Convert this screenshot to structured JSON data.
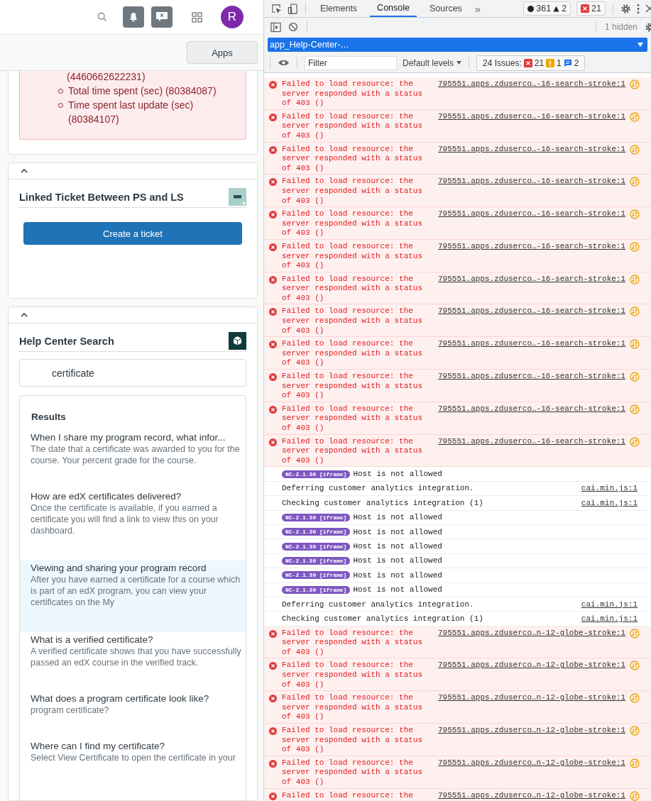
{
  "topbar": {
    "avatar_letter": "R"
  },
  "subbar": {
    "apps_button": "Apps"
  },
  "alert_card": {
    "lines": [
      {
        "kind": "tail",
        "text": "(4460662622231)"
      },
      {
        "kind": "bullet",
        "text": "Total time spent (sec) (80384087)"
      },
      {
        "kind": "bullet",
        "text": "Time spent last update (sec) (80384107)"
      }
    ]
  },
  "linked_ticket_card": {
    "expanded": true,
    "title": "Linked Ticket Between PS and LS",
    "button": "Create a ticket"
  },
  "help_center_card": {
    "expanded": true,
    "title": "Help Center Search",
    "search": {
      "value": "certificate"
    },
    "results_heading": "Results",
    "results": [
      {
        "title": "When I share my program record, what infor...",
        "snippet": "The date that a certificate was awarded to you for the course. Your percent grade for the course.",
        "selected": false
      },
      {
        "title": "How are edX certificates delivered?",
        "snippet": "Once the certificate is available, if you earned a certificate you will find a link to view this on your dashboard.",
        "selected": false
      },
      {
        "title": "Viewing and sharing your program record",
        "snippet": "After you have earned a certificate for a course which is part of an edX program, you can view your certificates on the My",
        "selected": true
      },
      {
        "title": "What is a verified certificate?",
        "snippet": "A verified certificate shows that you have successfully passed an edX course in the verified track.",
        "selected": false
      },
      {
        "title": "What does a program certificate look like?",
        "snippet": "program certificate?",
        "selected": false
      },
      {
        "title": "Where can I find my certificate?",
        "snippet": "Select View Certificate to open the certificate in your",
        "selected": false
      }
    ]
  },
  "devtools": {
    "tabs": [
      {
        "label": "Elements",
        "selected": false
      },
      {
        "label": "Console",
        "selected": true
      },
      {
        "label": "Sources",
        "selected": false
      }
    ],
    "more_tabs": "»",
    "counts": {
      "messages": "361",
      "warnings": "2",
      "errors": "21"
    },
    "hidden_count": "1 hidden",
    "context": "app_Help-Center-…",
    "filter": {
      "placeholder": "Filter"
    },
    "levels": "Default levels",
    "issues": {
      "label": "24 Issues:",
      "errors": "21",
      "warnings": "1",
      "info": "2"
    },
    "log": [
      {
        "kind": "error",
        "text": "Failed to load resource: the server responded with a status of 403 ()",
        "source": "795551.apps.zduserco…-16-search-stroke:1"
      },
      {
        "kind": "error",
        "text": "Failed to load resource: the server responded with a status of 403 ()",
        "source": "795551.apps.zduserco…-16-search-stroke:1"
      },
      {
        "kind": "error",
        "text": "Failed to load resource: the server responded with a status of 403 ()",
        "source": "795551.apps.zduserco…-16-search-stroke:1"
      },
      {
        "kind": "error",
        "text": "Failed to load resource: the server responded with a status of 403 ()",
        "source": "795551.apps.zduserco…-16-search-stroke:1"
      },
      {
        "kind": "error",
        "text": "Failed to load resource: the server responded with a status of 403 ()",
        "source": "795551.apps.zduserco…-16-search-stroke:1"
      },
      {
        "kind": "error",
        "text": "Failed to load resource: the server responded with a status of 403 ()",
        "source": "795551.apps.zduserco…-16-search-stroke:1"
      },
      {
        "kind": "error",
        "text": "Failed to load resource: the server responded with a status of 403 ()",
        "source": "795551.apps.zduserco…-16-search-stroke:1"
      },
      {
        "kind": "error",
        "text": "Failed to load resource: the server responded with a status of 403 ()",
        "source": "795551.apps.zduserco…-16-search-stroke:1"
      },
      {
        "kind": "error",
        "text": "Failed to load resource: the server responded with a status of 403 ()",
        "source": "795551.apps.zduserco…-16-search-stroke:1"
      },
      {
        "kind": "error",
        "text": "Failed to load resource: the server responded with a status of 403 ()",
        "source": "795551.apps.zduserco…-16-search-stroke:1"
      },
      {
        "kind": "error",
        "text": "Failed to load resource: the server responded with a status of 403 ()",
        "source": "795551.apps.zduserco…-16-search-stroke:1"
      },
      {
        "kind": "error",
        "text": "Failed to load resource: the server responded with a status of 403 ()",
        "source": "795551.apps.zduserco…-16-search-stroke:1"
      },
      {
        "kind": "badge",
        "badge": "NC-2.1.30 [iframe]",
        "text": "Host is not allowed"
      },
      {
        "kind": "info",
        "text": "Deferring customer analytics integration.",
        "source": "cai.min.js:1"
      },
      {
        "kind": "info",
        "text": "Checking customer analytics integration (1)",
        "source": "cai.min.js:1"
      },
      {
        "kind": "badge",
        "badge": "NC-2.1.30 [iframe]",
        "text": "Host is not allowed"
      },
      {
        "kind": "badge",
        "badge": "NC-2.1.30 [iframe]",
        "text": "Host is not allowed"
      },
      {
        "kind": "badge",
        "badge": "NC-2.1.30 [iframe]",
        "text": "Host is not allowed"
      },
      {
        "kind": "badge",
        "badge": "NC-2.1.30 [iframe]",
        "text": "Host is not allowed"
      },
      {
        "kind": "badge",
        "badge": "NC-2.1.30 [iframe]",
        "text": "Host is not allowed"
      },
      {
        "kind": "badge",
        "badge": "NC-2.1.30 [iframe]",
        "text": "Host is not allowed"
      },
      {
        "kind": "info",
        "text": "Deferring customer analytics integration.",
        "source": "cai.min.js:1"
      },
      {
        "kind": "info",
        "text": "Checking customer analytics integration (1)",
        "source": "cai.min.js:1"
      },
      {
        "kind": "error",
        "text": "Failed to load resource: the server responded with a status of 403 ()",
        "source": "795551.apps.zduserco…n-12-globe-stroke:1"
      },
      {
        "kind": "error",
        "text": "Failed to load resource: the server responded with a status of 403 ()",
        "source": "795551.apps.zduserco…n-12-globe-stroke:1"
      },
      {
        "kind": "error",
        "text": "Failed to load resource: the server responded with a status of 403 ()",
        "source": "795551.apps.zduserco…n-12-globe-stroke:1"
      },
      {
        "kind": "error",
        "text": "Failed to load resource: the server responded with a status of 403 ()",
        "source": "795551.apps.zduserco…n-12-globe-stroke:1"
      },
      {
        "kind": "error",
        "text": "Failed to load resource: the server responded with a status of 403 ()",
        "source": "795551.apps.zduserco…n-12-globe-stroke:1"
      },
      {
        "kind": "error",
        "text": "Failed to load resource: the",
        "source": "795551.apps.zduserco…n-12-globe-stroke:1"
      }
    ]
  }
}
